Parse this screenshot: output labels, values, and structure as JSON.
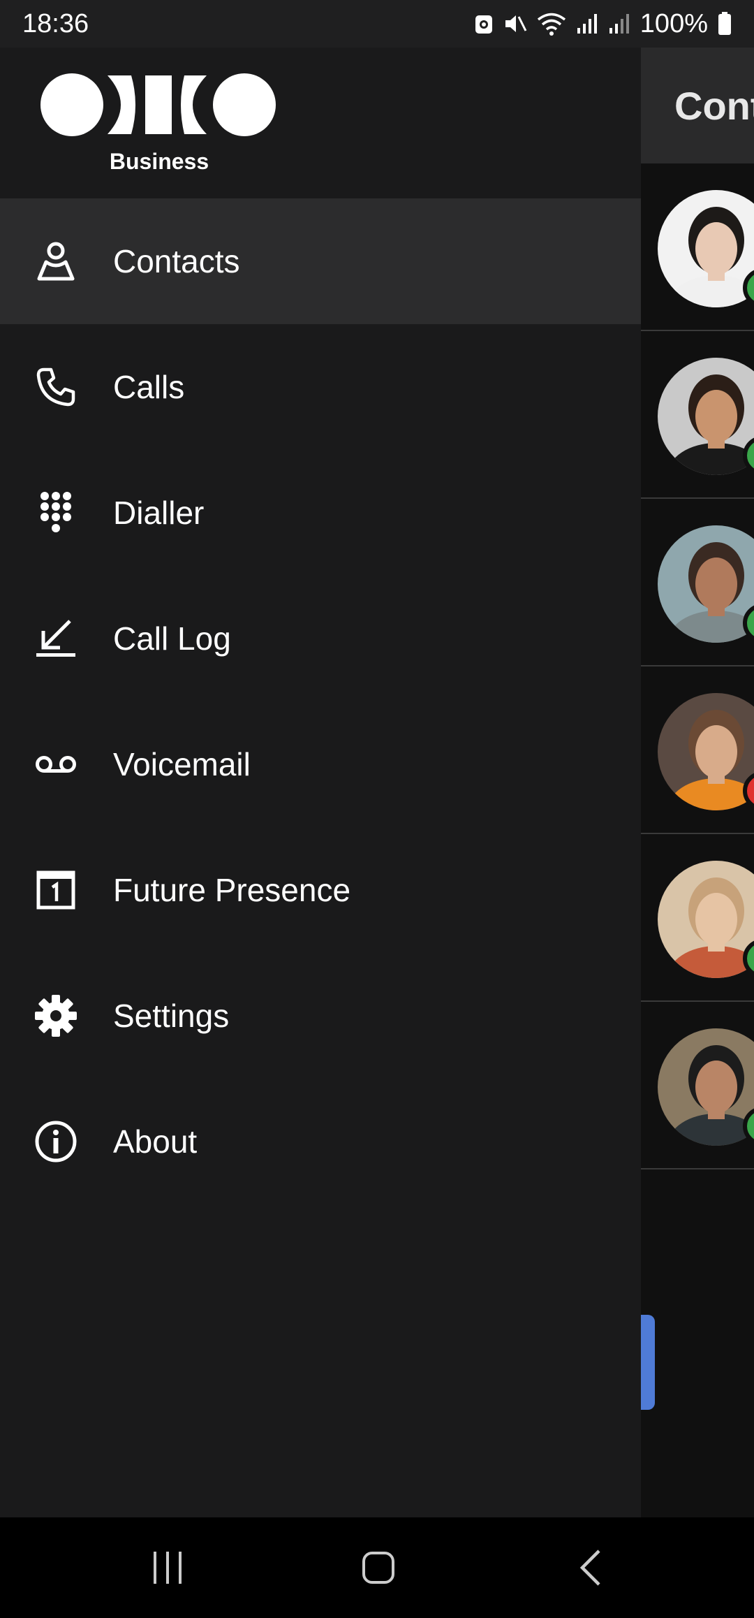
{
  "status_bar": {
    "time": "18:36",
    "battery_text": "100%"
  },
  "logo": {
    "wordmark": "Business"
  },
  "menu": {
    "items": [
      {
        "label": "Contacts",
        "icon": "contacts-icon",
        "active": true
      },
      {
        "label": "Calls",
        "icon": "phone-icon",
        "active": false
      },
      {
        "label": "Dialler",
        "icon": "dialpad-icon",
        "active": false
      },
      {
        "label": "Call Log",
        "icon": "call-log-icon",
        "active": false
      },
      {
        "label": "Voicemail",
        "icon": "voicemail-icon",
        "active": false
      },
      {
        "label": "Future Presence",
        "icon": "calendar-icon",
        "active": false
      },
      {
        "label": "Settings",
        "icon": "gear-icon",
        "active": false
      },
      {
        "label": "About",
        "icon": "info-icon",
        "active": false
      }
    ]
  },
  "background_screen": {
    "header_title": "Cont",
    "contacts": [
      {
        "presence": "available",
        "presence_color": "#3aa64a"
      },
      {
        "presence": "available",
        "presence_color": "#3aa64a"
      },
      {
        "presence": "available",
        "presence_color": "#3aa64a"
      },
      {
        "presence": "busy",
        "presence_color": "#e0312f"
      },
      {
        "presence": "available",
        "presence_color": "#3aa64a"
      },
      {
        "presence": "available",
        "presence_color": "#3aa64a"
      }
    ]
  },
  "colors": {
    "drawer_bg": "#1a1a1b",
    "active_item_bg": "#2c2c2d",
    "accent": "#4f7bd6"
  }
}
